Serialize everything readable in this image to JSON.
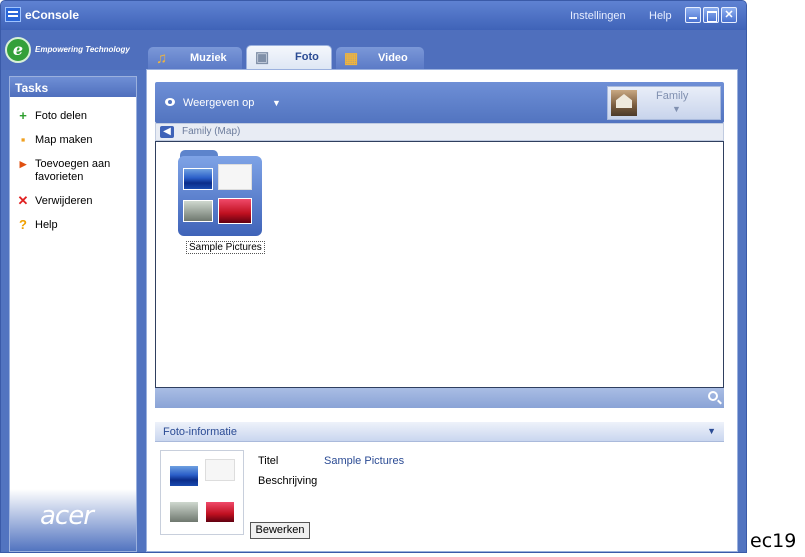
{
  "window": {
    "title": "eConsole",
    "links": [
      "Instellingen",
      "Help"
    ]
  },
  "brand": {
    "logo_letter": "e",
    "tagline": "Empowering Technology",
    "vendor": "acer"
  },
  "tabs": [
    {
      "label": "Muziek",
      "icon": "music-note-icon",
      "active": false
    },
    {
      "label": "Foto",
      "icon": "photo-icon",
      "active": true
    },
    {
      "label": "Video",
      "icon": "film-icon",
      "active": false
    }
  ],
  "sidebar": {
    "header": "Tasks",
    "items": [
      {
        "label": "Foto delen",
        "icon": "plus-icon",
        "color": "#2e9e2e"
      },
      {
        "label": "Map maken",
        "icon": "folder-new-icon",
        "color": "#f0a020"
      },
      {
        "label": "Toevoegen aan favorieten",
        "icon": "favorite-folder-icon",
        "color": "#e05010"
      },
      {
        "label": "Verwijderen",
        "icon": "delete-icon",
        "color": "#e02020"
      },
      {
        "label": "Help",
        "icon": "help-icon",
        "color": "#f0a000"
      }
    ]
  },
  "viewbar": {
    "label": "Weergeven op",
    "album": "Family"
  },
  "breadcrumb": "Family (Map)",
  "folder": {
    "label": "Sample Pictures"
  },
  "info": {
    "header": "Foto-informatie",
    "title_label": "Titel",
    "title_value": "Sample Pictures",
    "desc_label": "Beschrijving",
    "edit_button": "Bewerken"
  },
  "overlay_text": "ec19",
  "colors": {
    "accent": "#5274c0",
    "link_blue": "#2b4b94"
  }
}
